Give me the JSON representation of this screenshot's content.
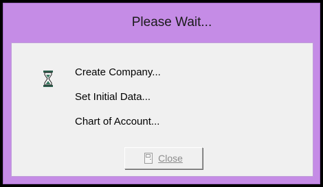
{
  "dialog": {
    "title": "Please Wait...",
    "accent_color": "#c58ce6",
    "status_icon": "hourglass-icon",
    "steps": [
      "Create Company...",
      "Set Initial Data...",
      "Chart of Account..."
    ],
    "close_button": {
      "label": "Close",
      "icon": "door-icon",
      "enabled": false
    }
  }
}
